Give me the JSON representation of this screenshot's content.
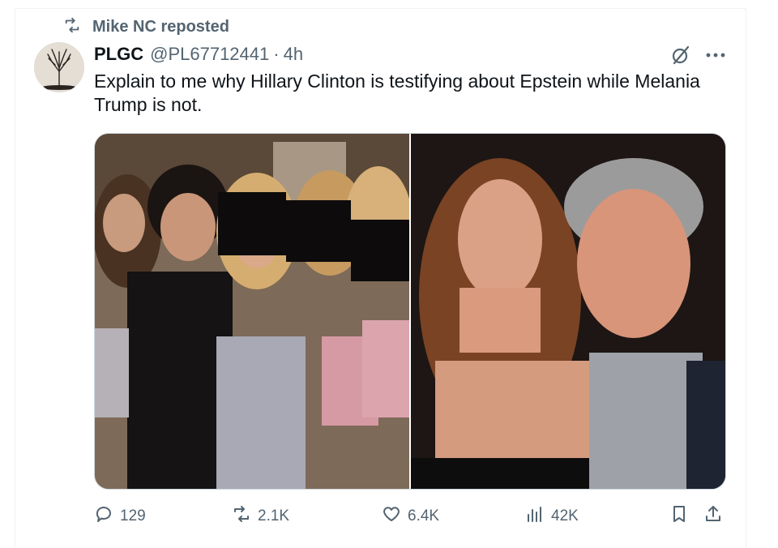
{
  "repost": {
    "label": "Mike NC reposted"
  },
  "tweet": {
    "name": "PLGC",
    "handle": "@PL67712441",
    "separator": "·",
    "time": "4h",
    "text": "Explain to me why Hillary Clinton is testifying about Epstein while Melania Trump is not."
  },
  "actions": {
    "replies": "129",
    "reposts": "2.1K",
    "likes": "6.4K",
    "views": "42K"
  },
  "icons": {
    "repost": "repost-icon",
    "reply": "reply-icon",
    "like": "heart-icon",
    "views": "views-bar-chart-icon",
    "bookmark": "bookmark-icon",
    "share": "share-icon",
    "grok": "grok-icon",
    "more": "more-icon"
  },
  "colors": {
    "secondary_text": "#536471",
    "primary_text": "#0f1419",
    "border": "#cfd9de"
  }
}
